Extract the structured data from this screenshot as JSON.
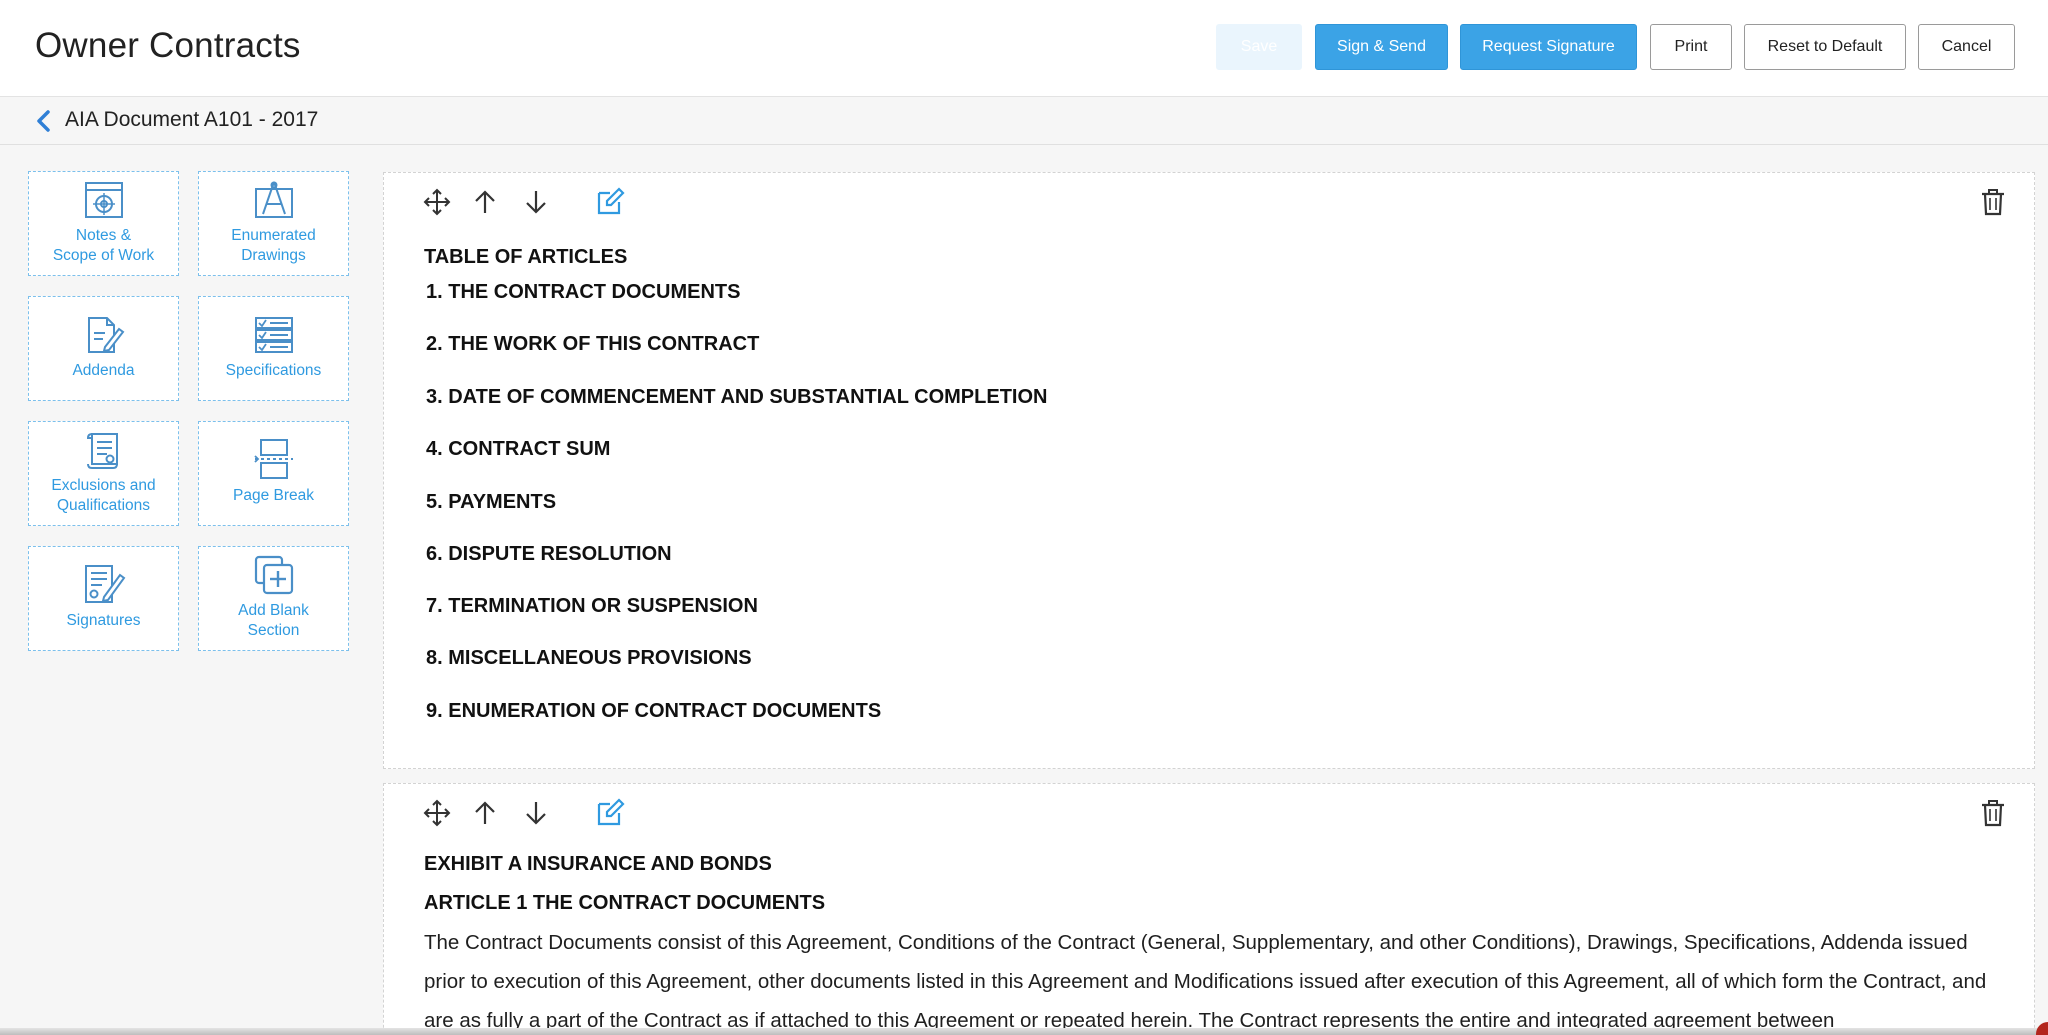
{
  "header": {
    "title": "Owner Contracts",
    "buttons": {
      "save": "Save",
      "sign_send": "Sign & Send",
      "request_signature": "Request Signature",
      "print": "Print",
      "reset_default": "Reset to Default",
      "cancel": "Cancel"
    }
  },
  "breadcrumb": {
    "title": "AIA Document A101 - 2017"
  },
  "sidebar": {
    "tiles": [
      {
        "line1": "Notes &",
        "line2": "Scope of Work",
        "icon": "target-blueprint-icon"
      },
      {
        "line1": "Enumerated",
        "line2": "Drawings",
        "icon": "compass-drawing-icon"
      },
      {
        "line1": "Addenda",
        "line2": "",
        "icon": "document-edit-icon"
      },
      {
        "line1": "Specifications",
        "line2": "",
        "icon": "checklist-icon"
      },
      {
        "line1": "Exclusions and",
        "line2": "Qualifications",
        "icon": "scroll-certificate-icon"
      },
      {
        "line1": "Page Break",
        "line2": "",
        "icon": "page-break-icon"
      },
      {
        "line1": "Signatures",
        "line2": "",
        "icon": "signature-document-icon"
      },
      {
        "line1": "Add Blank",
        "line2": "Section",
        "icon": "add-section-icon"
      }
    ]
  },
  "sections": [
    {
      "heading": "TABLE OF ARTICLES",
      "items": [
        "1. THE CONTRACT DOCUMENTS",
        "2. THE WORK OF THIS CONTRACT",
        "3. DATE OF COMMENCEMENT AND SUBSTANTIAL COMPLETION",
        "4. CONTRACT SUM",
        "5. PAYMENTS",
        "6. DISPUTE RESOLUTION",
        "7. TERMINATION OR SUSPENSION",
        "8. MISCELLANEOUS PROVISIONS",
        "9. ENUMERATION OF CONTRACT DOCUMENTS"
      ]
    },
    {
      "heading1": "EXHIBIT A INSURANCE AND BONDS",
      "heading2": "ARTICLE 1 THE CONTRACT DOCUMENTS",
      "body": "The Contract Documents consist of this Agreement, Conditions of the Contract (General, Supplementary, and other Conditions), Drawings, Specifications, Addenda issued prior to execution of this Agreement, other documents listed in this Agreement and Modifications issued after execution of this Agreement, all of which form the Contract, and are as fully a part of the Contract as if attached to this Agreement or repeated herein. The Contract represents the entire and integrated agreement between"
    }
  ],
  "colors": {
    "accent": "#3ba3e6",
    "tile_text": "#2f9ae0",
    "tool_icon": "#333333",
    "edit_icon": "#2f9ae0"
  }
}
